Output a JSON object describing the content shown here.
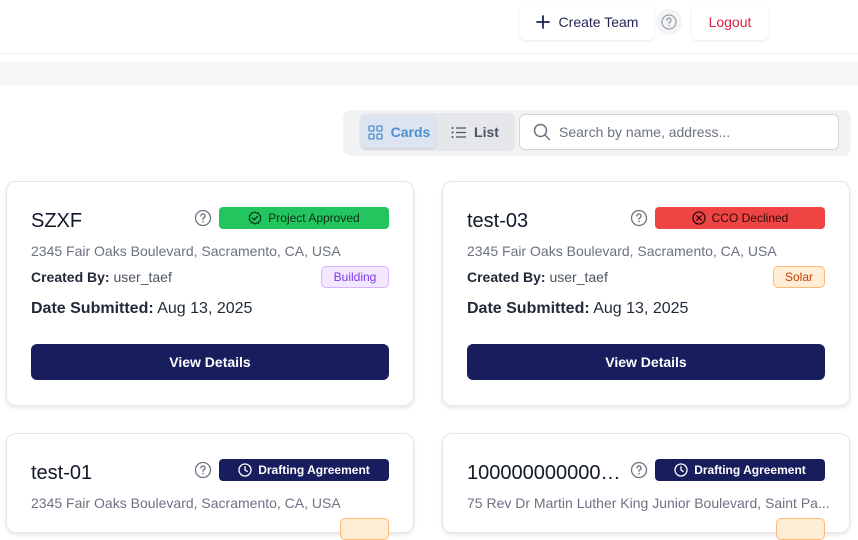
{
  "header": {
    "create_team_label": "Create Team",
    "logout_label": "Logout"
  },
  "toolbar": {
    "cards_label": "Cards",
    "list_label": "List",
    "active_view": "Cards",
    "search_placeholder": "Search by name, address...",
    "search_value": ""
  },
  "colors": {
    "primary": "#181d5e",
    "approved": "#22c55e",
    "declined": "#ef4444",
    "logout": "#e11d48",
    "accent_blue": "#4c8fd1"
  },
  "cards": [
    {
      "title": "SZXF",
      "status": "Project Approved",
      "status_icon": "check-badge-icon",
      "address": "2345 Fair Oaks Boulevard, Sacramento, CA, USA",
      "created_by_label": "Created By:",
      "created_by": "user_taef",
      "tag": "Building",
      "date_label": "Date Submitted:",
      "date": "Aug 13, 2025",
      "button_label": "View Details"
    },
    {
      "title": "test-03",
      "status": "CCO Declined",
      "status_icon": "x-circle-icon",
      "address": "2345 Fair Oaks Boulevard, Sacramento, CA, USA",
      "created_by_label": "Created By:",
      "created_by": "user_taef",
      "tag": "Solar",
      "date_label": "Date Submitted:",
      "date": "Aug 13, 2025",
      "button_label": "View Details"
    },
    {
      "title": "test-01",
      "status": "Drafting Agreement",
      "status_icon": "clock-icon",
      "address": "2345 Fair Oaks Boulevard, Sacramento, CA, USA"
    },
    {
      "title": "1000000000000...",
      "status": "Drafting Agreement",
      "status_icon": "clock-icon",
      "address": "75 Rev Dr Martin Luther King Junior Boulevard, Saint Pa..."
    }
  ]
}
